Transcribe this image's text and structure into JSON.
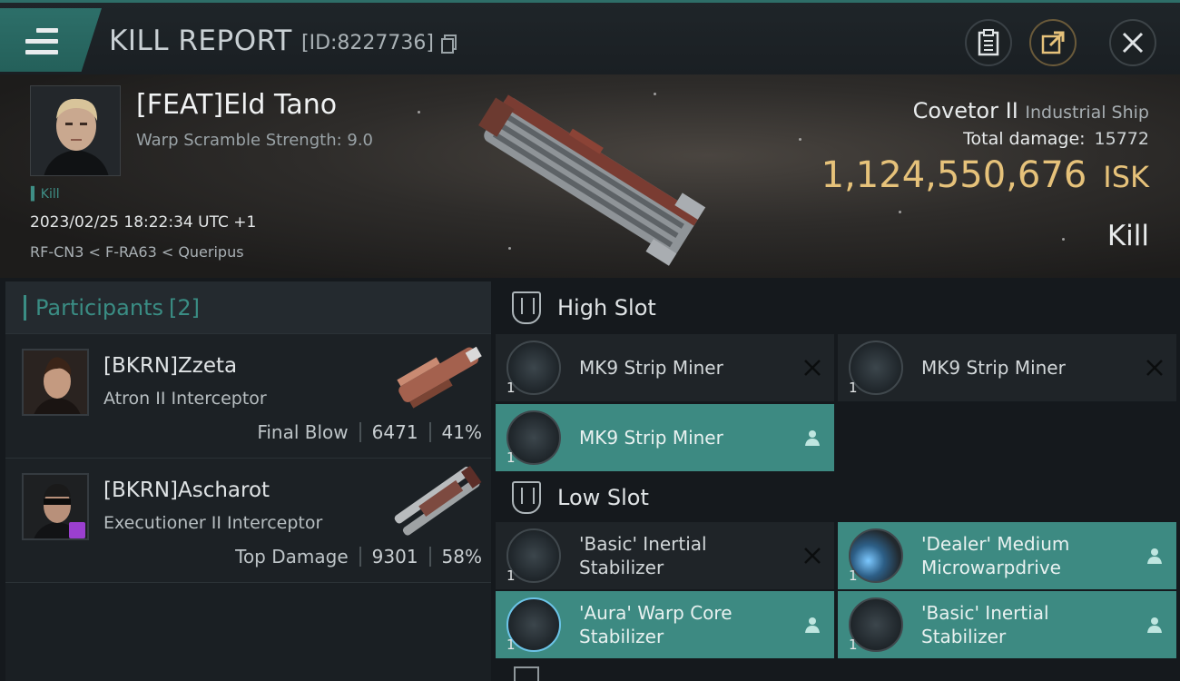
{
  "window": {
    "title": "KILL REPORT",
    "report_id": "[ID:8227736]"
  },
  "victim": {
    "name": "[FEAT]Eld Tano",
    "warp_scramble": "Warp Scramble Strength: 9.0",
    "tag": "Kill",
    "time": "2023/02/25 18:22:34 UTC +1",
    "location": "RF-CN3 < F-RA63 < Queripus",
    "ship_name": "Covetor II",
    "ship_type": "Industrial Ship",
    "total_damage_label": "Total damage:",
    "total_damage": "15772",
    "isk_value": "1,124,550,676",
    "isk_unit": "ISK",
    "result": "Kill"
  },
  "participants": {
    "label": "Participants",
    "count": "[2]",
    "rows": [
      {
        "name": "[BKRN]Zzeta",
        "ship": "Atron II Interceptor",
        "role": "Final Blow",
        "damage": "6471",
        "percent": "41%"
      },
      {
        "name": "[BKRN]Ascharot",
        "ship": "Executioner II Interceptor",
        "role": "Top Damage",
        "damage": "9301",
        "percent": "58%"
      }
    ]
  },
  "fitting": {
    "high_slot": {
      "title": "High Slot",
      "modules": [
        {
          "name": "MK9 Strip Miner",
          "qty": "1",
          "status": "destroyed"
        },
        {
          "name": "MK9 Strip Miner",
          "qty": "1",
          "status": "destroyed"
        },
        {
          "name": "MK9 Strip Miner",
          "qty": "1",
          "status": "dropped"
        }
      ]
    },
    "low_slot": {
      "title": "Low Slot",
      "modules": [
        {
          "name": "'Basic' Inertial Stabilizer",
          "qty": "1",
          "status": "destroyed"
        },
        {
          "name": "'Dealer' Medium Microwarpdrive",
          "qty": "1",
          "status": "dropped"
        },
        {
          "name": "'Aura' Warp Core Stabilizer",
          "qty": "1",
          "status": "dropped"
        },
        {
          "name": "'Basic' Inertial Stabilizer",
          "qty": "1",
          "status": "dropped"
        }
      ]
    }
  },
  "colors": {
    "accent": "#3a8d84",
    "isk": "#e6c27a",
    "dropped_bg": "#3d8a82",
    "destroyed_bg": "#1f2428"
  }
}
